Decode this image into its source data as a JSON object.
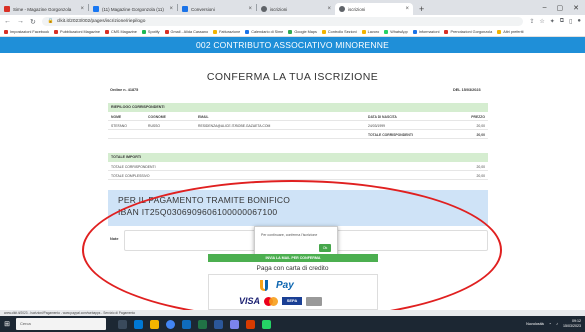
{
  "browser": {
    "tabs": [
      {
        "label": "Sime - Magazine Gorgonzola",
        "fav": "#d93025",
        "active": false
      },
      {
        "label": "(11) Magazine Gorgonzola (11)",
        "fav": "#1877f2",
        "active": false
      },
      {
        "label": "Conversioni",
        "fav": "#1a73e8",
        "active": false
      },
      {
        "label": "iscrizioni",
        "fav": "#5f6368",
        "active": false
      },
      {
        "label": "iscrizioni",
        "fav": "#5f6368",
        "active": true
      }
    ],
    "new_tab_glyph": "+",
    "url": "clkit.it/2023/002/pages/iscrizione/riepilogo",
    "bookmarks": [
      "Impostazioni Facebook",
      "Pubblicazioni Magazine",
      "CMS Magazine",
      "Spotify",
      "Gmail - Alida Cassano",
      "Fatturazione",
      "Calendario di Sime",
      "Google Maps",
      "Controllo Sezioni",
      "Lavoro",
      "WhatsApp",
      "Informazioni",
      "Prenotazioni Gorgonzola",
      "Altri preferiti"
    ]
  },
  "page": {
    "banner": "002 CONTRIBUTO ASSOCIATIVO MINORENNE",
    "heading": "CONFERMA LA TUA ISCRIZIONE",
    "order_number": "Ordine n. 41875",
    "order_date": "DEL 15/03/2023",
    "riepilogo": {
      "title": "RIEPILOGO CORRISPONDENTI",
      "columns": [
        "NOME",
        "COGNOME",
        "EMAIL",
        "DATA DI NASCITA",
        "PREZZO"
      ],
      "row": [
        "STEFANO",
        "RUSSO",
        "RESIDENZA@ALICE.IT/BOBE.GAZAETA.COM",
        "24/03/1999",
        "20,00"
      ],
      "total_label": "TOTALE CORRISPONDENTI",
      "total_value": "20,00"
    },
    "totali": {
      "title": "TOTALE IMPORTI",
      "rows": [
        {
          "label": "TOTALE CORRISPONDENTI",
          "value": "20,00"
        },
        {
          "label": "TOTALE COMPLESSIVO",
          "value": "20,00"
        }
      ]
    },
    "bank": {
      "title": "PER IL PAGAMENTO TRAMITE BONIFICO",
      "iban": "IBAN  IT25Q0306909606100000067100"
    },
    "note_label": "Note",
    "dialog": {
      "message": "Per continuare, conferma l'iscrizione",
      "ok_label": "Ok"
    },
    "send_button": "INVIA LA MAIL PER CONFERMA",
    "card_title": "Paga con carta di credito",
    "payment": {
      "upay_label": "Pay",
      "visa_label": "VISA",
      "sepa_label": "SEPA"
    }
  },
  "statusbar": "www.clkit.it/2023 - Iscrizioni/Pagamento - www.paypal.com/webapps - Servizio di Pagamento",
  "taskbar": {
    "search_placeholder": "Cerca",
    "clock_time": "09:12",
    "clock_date": "15/03/2023",
    "weather": "Nuvolosità"
  },
  "colors": {
    "banner": "#1f8fd8",
    "section": "#d5edd0",
    "bank": "#cfe3f7",
    "accent_green": "#4caf50",
    "annotation": "#e02020"
  }
}
